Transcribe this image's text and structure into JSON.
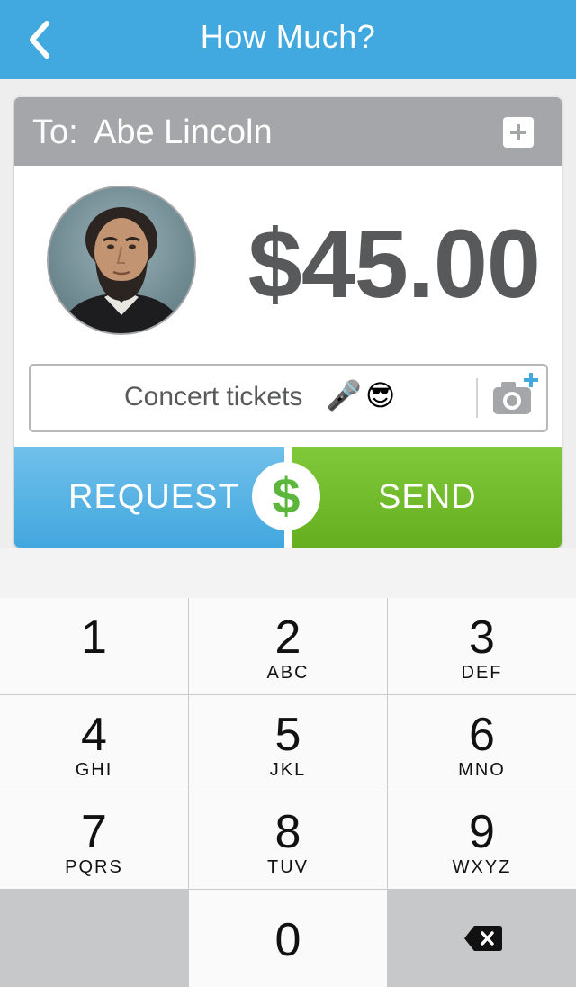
{
  "header": {
    "title": "How Much?",
    "back_icon": "chevron-left-icon"
  },
  "recipient": {
    "to_label": "To:",
    "name": "Abe Lincoln",
    "add_icon": "plus-box-icon"
  },
  "payment": {
    "amount": "$45.00"
  },
  "note": {
    "text": "Concert tickets",
    "emoji": [
      "🎤",
      "😎"
    ],
    "camera_icon": "camera-add-icon"
  },
  "actions": {
    "request_label": "REQUEST",
    "send_label": "SEND",
    "center_badge": "$",
    "colors": {
      "request": "#42a7df",
      "send": "#64ae20",
      "badge": "#5ab73b"
    }
  },
  "keypad": {
    "keys": [
      {
        "number": "1",
        "letters": ""
      },
      {
        "number": "2",
        "letters": "ABC"
      },
      {
        "number": "3",
        "letters": "DEF"
      },
      {
        "number": "4",
        "letters": "GHI"
      },
      {
        "number": "5",
        "letters": "JKL"
      },
      {
        "number": "6",
        "letters": "MNO"
      },
      {
        "number": "7",
        "letters": "PQRS"
      },
      {
        "number": "8",
        "letters": "TUV"
      },
      {
        "number": "9",
        "letters": "WXYZ"
      },
      {
        "number": "0",
        "letters": ""
      }
    ],
    "backspace_icon": "backspace-icon"
  },
  "theme": {
    "accent": "#42a9e0",
    "header_gray": "#a5a6a9",
    "amount_text": "#58595b"
  }
}
